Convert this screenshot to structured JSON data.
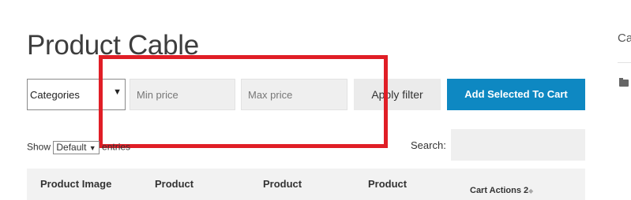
{
  "page": {
    "title": "Product Cable"
  },
  "filters": {
    "category_selected": "Categories",
    "min_price_placeholder": "Min price",
    "max_price_placeholder": "Max price",
    "apply_label": "Apply filter",
    "add_to_cart_label": "Add Selected To Cart"
  },
  "table_controls": {
    "show_label": "Show",
    "length_selected": "Default",
    "entries_label": "entries",
    "search_label": "Search:"
  },
  "table": {
    "headers": [
      "Product Image",
      "Product",
      "Product",
      "Product",
      "Cart Actions 2"
    ]
  },
  "sidebar": {
    "heading_partial": "Ca"
  },
  "colors": {
    "accent": "#0e88c2",
    "highlight_box": "#e01e26"
  },
  "icons": [
    "chevron-down-icon",
    "sort-icon",
    "folder-icon"
  ]
}
